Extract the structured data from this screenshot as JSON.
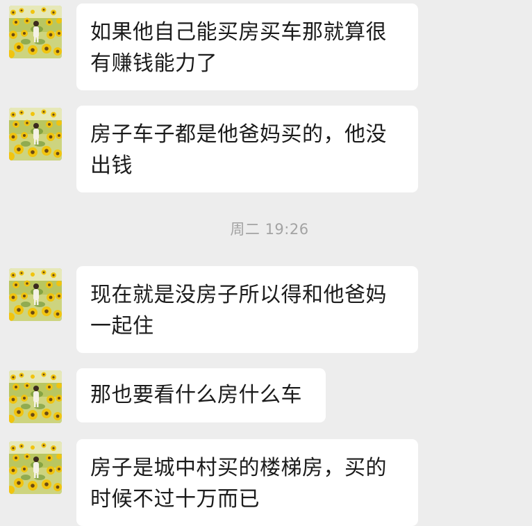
{
  "messages": [
    {
      "lines": [
        "如果他自己能买房买车那就算很",
        "有赚钱能力了"
      ]
    },
    {
      "lines": [
        "房子车子都是他爸妈买的，他没",
        "出钱"
      ]
    },
    {
      "lines": [
        "现在就是没房子所以得和他爸妈",
        "一起住"
      ]
    },
    {
      "lines": [
        "那也要看什么房什么车"
      ]
    },
    {
      "lines": [
        "房子是城中村买的楼梯房，买的",
        "时候不过十万而已"
      ]
    }
  ],
  "timestamp": "周二 19:26",
  "avatar_icon": "sunflower-field-avatar-icon",
  "colors": {
    "background": "#ededed",
    "bubble": "#ffffff",
    "text": "#1b1b1b",
    "timestamp": "#a3a3a3"
  }
}
